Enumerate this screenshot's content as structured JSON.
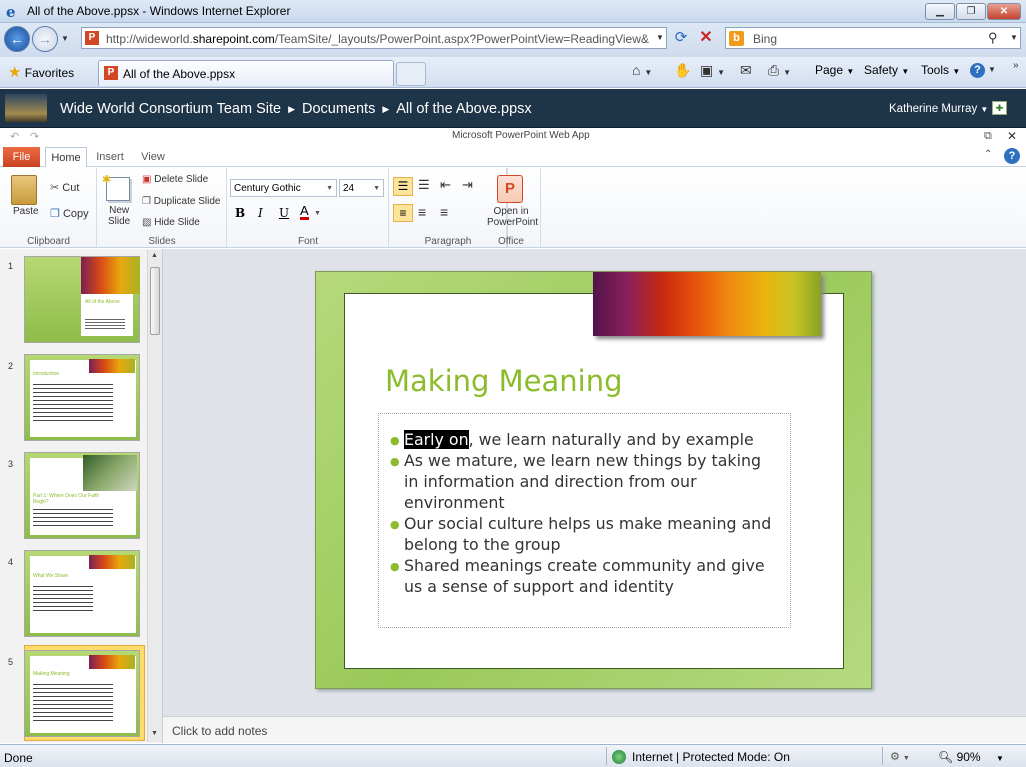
{
  "window": {
    "title": "All of the Above.ppsx - Windows Internet Explorer",
    "min_label": "▁",
    "max_label": "❐",
    "close_label": "✕"
  },
  "addressbar": {
    "url_prefix": "http://wideworld.",
    "url_domain": "sharepoint.com",
    "url_suffix": "/TeamSite/_layouts/PowerPoint.aspx?PowerPointView=ReadingView&",
    "search_placeholder": "Bing"
  },
  "favorites": {
    "label": "Favorites",
    "tab_title": "All of the Above.ppsx",
    "commands": [
      "Page",
      "Safety",
      "Tools"
    ]
  },
  "sharepoint": {
    "breadcrumb": [
      "Wide World Consortium Team Site",
      "Documents",
      "All of the Above.ppsx"
    ],
    "user": "Katherine Murray"
  },
  "app": {
    "title": "Microsoft PowerPoint Web App",
    "tabs": [
      "File",
      "Home",
      "Insert",
      "View"
    ]
  },
  "ribbon": {
    "clipboard": {
      "group": "Clipboard",
      "paste": "Paste",
      "cut": "Cut",
      "copy": "Copy"
    },
    "slides": {
      "group": "Slides",
      "new_slide_1": "New",
      "new_slide_2": "Slide",
      "delete": "Delete Slide",
      "duplicate": "Duplicate Slide",
      "hide": "Hide Slide"
    },
    "font": {
      "group": "Font",
      "name": "Century Gothic",
      "size": "24",
      "bold": "B",
      "italic": "I",
      "underline": "U",
      "color": "A"
    },
    "paragraph": {
      "group": "Paragraph"
    },
    "office": {
      "group": "Office",
      "open_1": "Open in",
      "open_2": "PowerPoint"
    }
  },
  "thumbnails": [
    {
      "num": "1",
      "title": "All of the Above"
    },
    {
      "num": "2",
      "title": "Introduction"
    },
    {
      "num": "3",
      "title": "Part 1: Where Does Our Faith Begin?"
    },
    {
      "num": "4",
      "title": "What We Share"
    },
    {
      "num": "5",
      "title": "Making Meaning"
    }
  ],
  "slide": {
    "title": "Making Meaning",
    "bullet1_highlight": "Early on",
    "bullet1_rest": ", we learn naturally and by example",
    "bullet2_l1": "As we mature, we learn new things by taking",
    "bullet2_l2": "in information and direction from our",
    "bullet2_l3": "environment",
    "bullet3_l1": "Our social culture helps us make meaning and",
    "bullet3_l2": "belong to the group",
    "bullet4_l1": "Shared meanings create community and give",
    "bullet4_l2": "us a sense of support and identity"
  },
  "notes": {
    "placeholder": "Click to add notes"
  },
  "statusbar": {
    "done": "Done",
    "zone": "Internet | Protected Mode: On",
    "zoom": "90%"
  }
}
